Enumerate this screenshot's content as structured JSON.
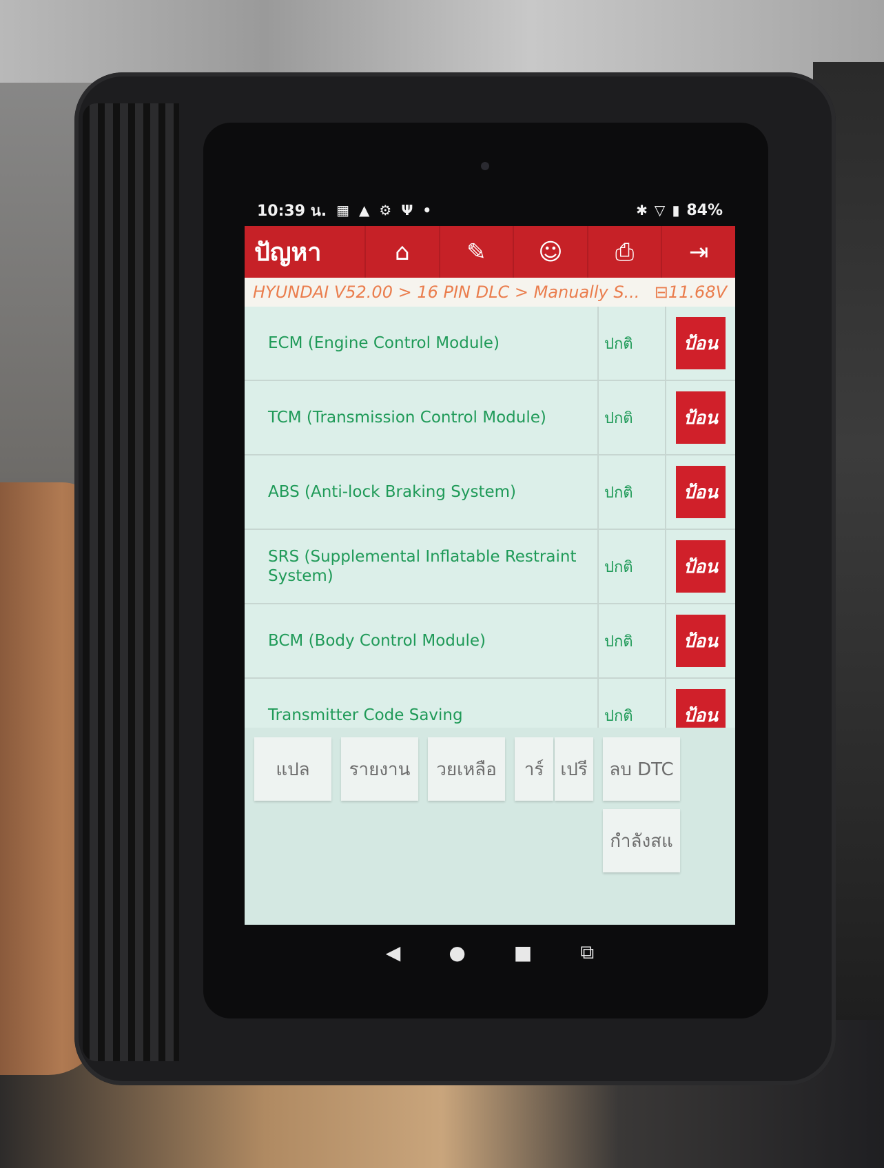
{
  "status_bar": {
    "time": "10:39 น.",
    "battery": "84%"
  },
  "toolbar": {
    "title": "ปัญหา"
  },
  "breadcrumb": {
    "path": "HYUNDAI V52.00 > 16 PIN DLC > Manually S...",
    "voltage": "11.68V"
  },
  "systems": [
    {
      "name": "ECM (Engine Control Module)",
      "status": "ปกติ",
      "action": "ป้อน"
    },
    {
      "name": "TCM (Transmission Control Module)",
      "status": "ปกติ",
      "action": "ป้อน"
    },
    {
      "name": "ABS (Anti-lock Braking System)",
      "status": "ปกติ",
      "action": "ป้อน"
    },
    {
      "name": "SRS (Supplemental Inflatable Restraint System)",
      "status": "ปกติ",
      "action": "ป้อน"
    },
    {
      "name": "BCM (Body Control Module)",
      "status": "ปกติ",
      "action": "ป้อน"
    },
    {
      "name": "Transmitter Code Saving",
      "status": "ปกติ",
      "action": "ป้อน"
    }
  ],
  "bottom_buttons": {
    "translate": "แปล",
    "report": "รายงาน",
    "help": "วยเหลือ",
    "share": "าร์",
    "compare": "เปรี",
    "clear_dtc": "ลบ DTC",
    "in_progress": "กำลังสแ"
  },
  "icons": {
    "home": "home-icon",
    "edit": "edit-icon",
    "user": "user-icon",
    "print": "print-icon",
    "exit": "exit-icon"
  }
}
